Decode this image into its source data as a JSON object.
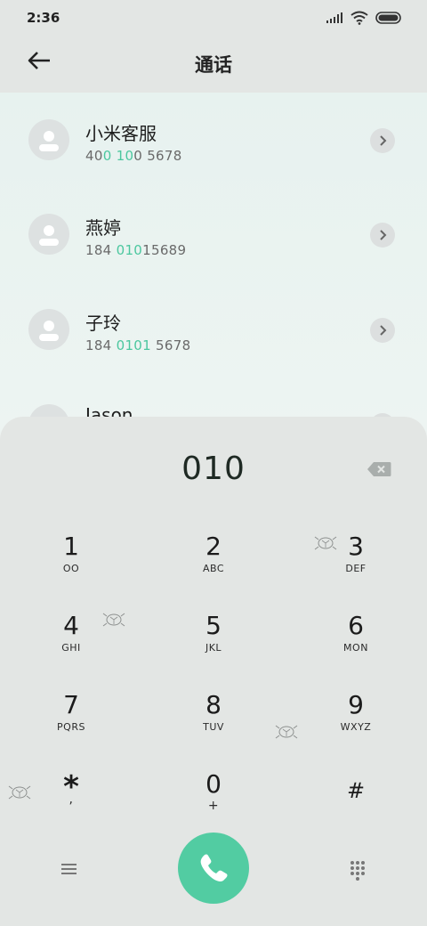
{
  "status": {
    "time": "2:36"
  },
  "header": {
    "title": "通话"
  },
  "contacts": [
    {
      "name": "小米客服",
      "number_parts": [
        "40",
        "0",
        " ",
        "10",
        "0 5678"
      ]
    },
    {
      "name": "燕婷",
      "number_parts": [
        "184 ",
        "010",
        "15689"
      ]
    },
    {
      "name": "子玲",
      "number_parts": [
        "184 ",
        "0101",
        " 5678"
      ]
    },
    {
      "name": "Jason"
    }
  ],
  "dialpad": {
    "entered": "010",
    "keys": [
      {
        "digit": "1",
        "letters": "OO"
      },
      {
        "digit": "2",
        "letters": "ABC"
      },
      {
        "digit": "3",
        "letters": "DEF"
      },
      {
        "digit": "4",
        "letters": "GHI"
      },
      {
        "digit": "5",
        "letters": "JKL"
      },
      {
        "digit": "6",
        "letters": "MON"
      },
      {
        "digit": "7",
        "letters": "PQRS"
      },
      {
        "digit": "8",
        "letters": "TUV"
      },
      {
        "digit": "9",
        "letters": "WXYZ"
      },
      {
        "digit": "*",
        "letters": ","
      },
      {
        "digit": "0",
        "letters": "+"
      },
      {
        "digit": "#",
        "letters": ""
      }
    ]
  },
  "colors": {
    "accent": "#4cc79f",
    "call": "#52cca2"
  },
  "icons": [
    "back-arrow-icon",
    "backspace-icon",
    "phone-icon",
    "menu-icon",
    "dialpad-grid-icon",
    "chevron-right-icon",
    "person-icon"
  ]
}
